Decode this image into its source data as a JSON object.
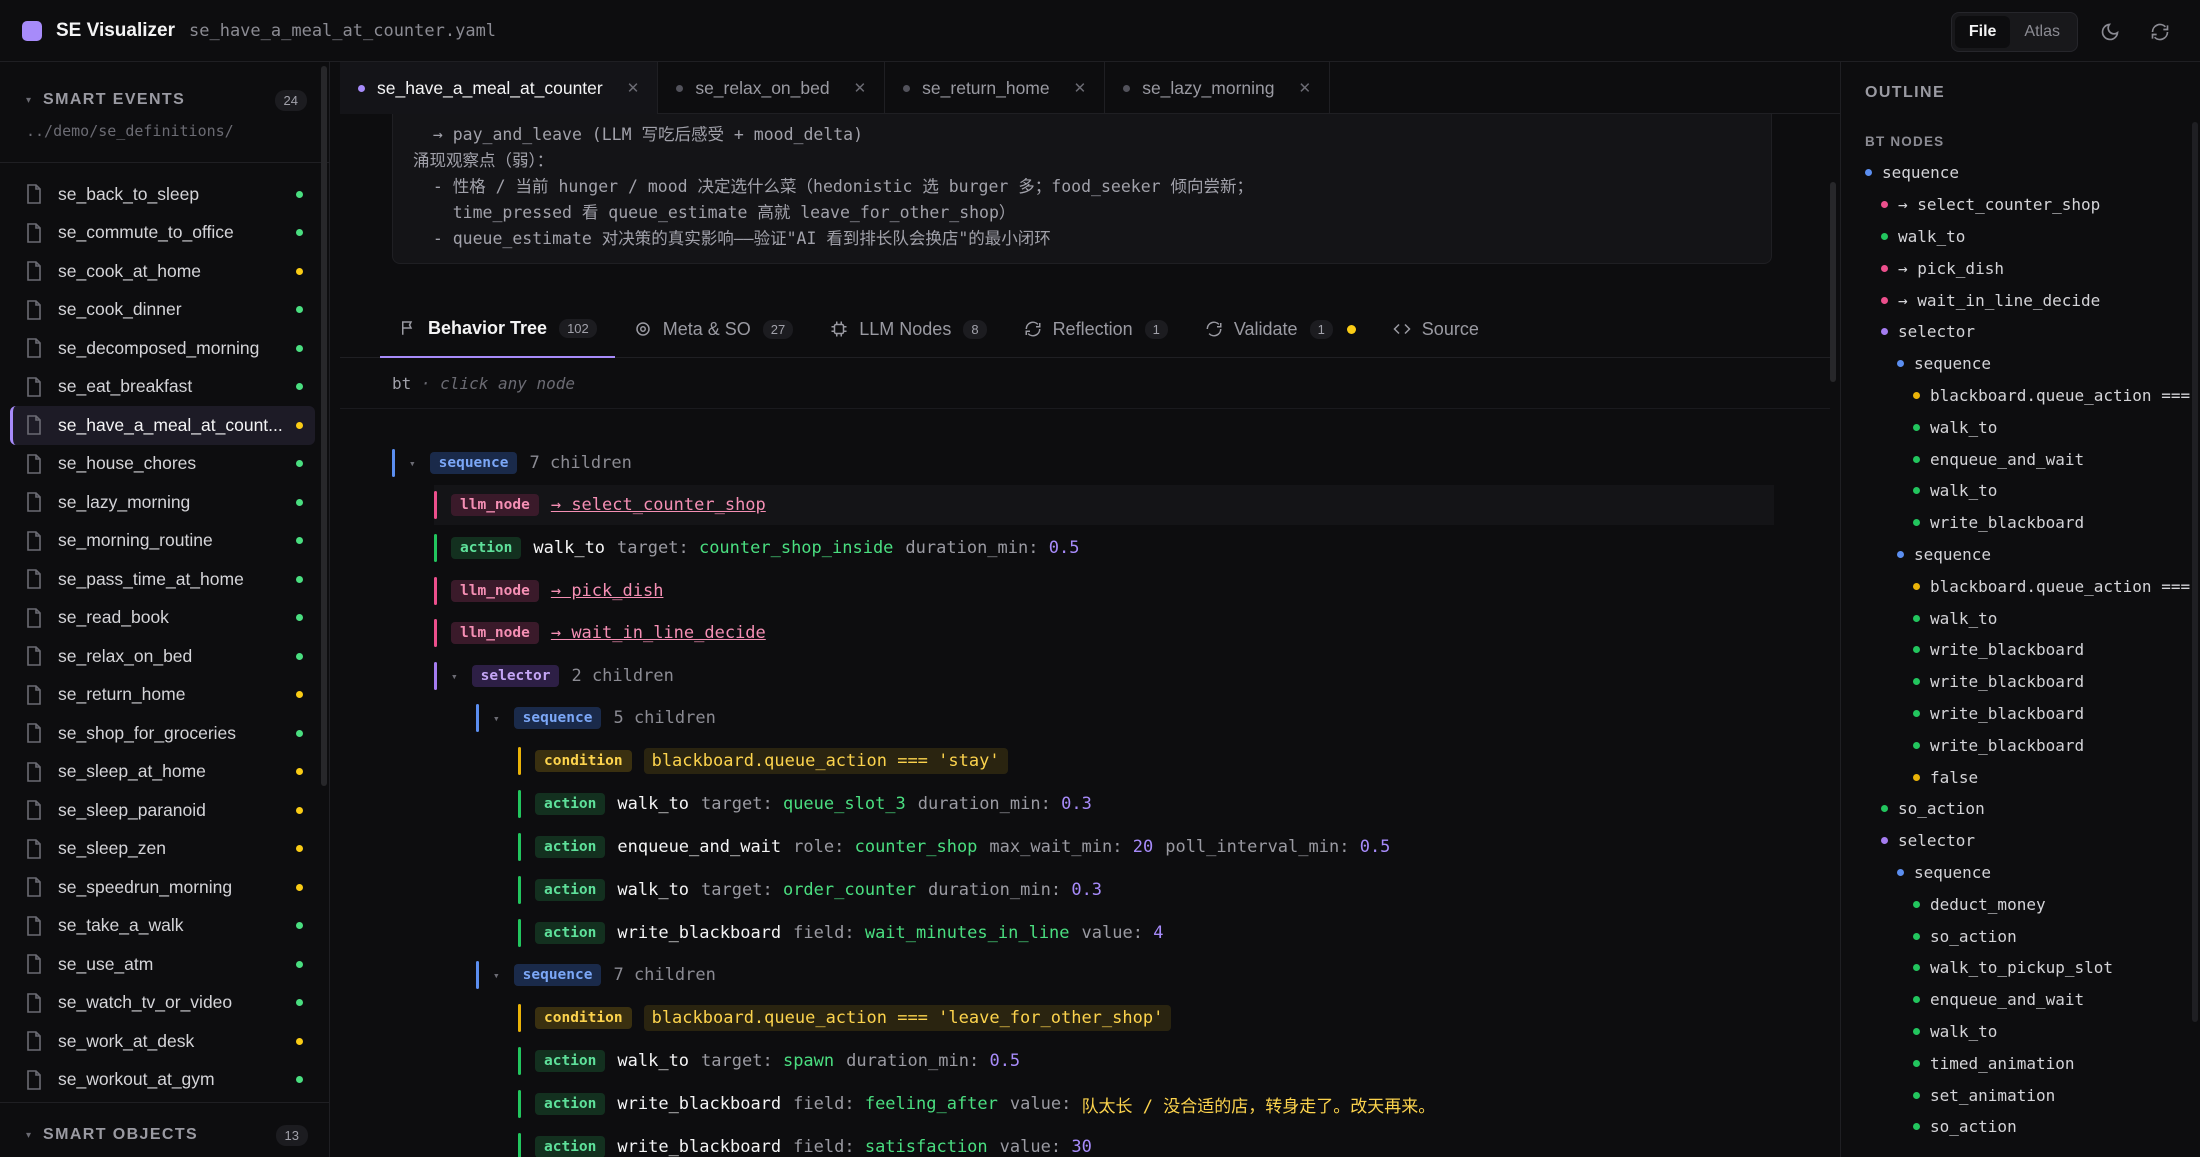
{
  "header": {
    "app_title": "SE Visualizer",
    "file_name": "se_have_a_meal_at_counter.yaml",
    "mode_file": "File",
    "mode_atlas": "Atlas"
  },
  "sidebar": {
    "smart_events_label": "SMART EVENTS",
    "smart_events_count": "24",
    "path": "../demo/se_definitions/",
    "items": [
      {
        "name": "se_back_to_sleep",
        "status": "green"
      },
      {
        "name": "se_commute_to_office",
        "status": "green"
      },
      {
        "name": "se_cook_at_home",
        "status": "yellow"
      },
      {
        "name": "se_cook_dinner",
        "status": "green"
      },
      {
        "name": "se_decomposed_morning",
        "status": "green"
      },
      {
        "name": "se_eat_breakfast",
        "status": "green"
      },
      {
        "name": "se_have_a_meal_at_count...",
        "status": "yellow",
        "active": true
      },
      {
        "name": "se_house_chores",
        "status": "green"
      },
      {
        "name": "se_lazy_morning",
        "status": "green"
      },
      {
        "name": "se_morning_routine",
        "status": "green"
      },
      {
        "name": "se_pass_time_at_home",
        "status": "green"
      },
      {
        "name": "se_read_book",
        "status": "green"
      },
      {
        "name": "se_relax_on_bed",
        "status": "green"
      },
      {
        "name": "se_return_home",
        "status": "yellow"
      },
      {
        "name": "se_shop_for_groceries",
        "status": "green"
      },
      {
        "name": "se_sleep_at_home",
        "status": "yellow"
      },
      {
        "name": "se_sleep_paranoid",
        "status": "yellow"
      },
      {
        "name": "se_sleep_zen",
        "status": "yellow"
      },
      {
        "name": "se_speedrun_morning",
        "status": "yellow"
      },
      {
        "name": "se_take_a_walk",
        "status": "green"
      },
      {
        "name": "se_use_atm",
        "status": "green"
      },
      {
        "name": "se_watch_tv_or_video",
        "status": "green"
      },
      {
        "name": "se_work_at_desk",
        "status": "yellow"
      },
      {
        "name": "se_workout_at_gym",
        "status": "green"
      }
    ],
    "smart_objects_label": "SMART OBJECTS",
    "smart_objects_count": "13"
  },
  "tabs": [
    {
      "label": "se_have_a_meal_at_counter",
      "active": true
    },
    {
      "label": "se_relax_on_bed"
    },
    {
      "label": "se_return_home"
    },
    {
      "label": "se_lazy_morning"
    }
  ],
  "notes": {
    "lines": [
      "  → pay_and_leave (LLM 写吃后感受 + mood_delta)",
      "涌现观察点（弱）：",
      "  - 性格 / 当前 hunger / mood 决定选什么菜（hedonistic 选 burger 多；food_seeker 倾向尝新；",
      "    time_pressed 看 queue_estimate 高就 leave_for_other_shop）",
      "  - queue_estimate 对决策的真实影响——验证\"AI 看到排长队会换店\"的最小闭环"
    ]
  },
  "subtabs": [
    {
      "label": "Behavior Tree",
      "count": "102",
      "active": true
    },
    {
      "label": "Meta & SO",
      "count": "27"
    },
    {
      "label": "LLM Nodes",
      "count": "8"
    },
    {
      "label": "Reflection",
      "count": "1"
    },
    {
      "label": "Validate",
      "count": "1"
    },
    {
      "label": "Source"
    }
  ],
  "bt": {
    "label": "bt",
    "hint": "· click any node"
  },
  "tree": {
    "root": {
      "tag": "sequence",
      "meta": "7 children"
    },
    "n1": {
      "tag": "llm_node",
      "link": "→ select_counter_shop"
    },
    "n2": {
      "tag": "action",
      "fn": "walk_to",
      "k1": "target:",
      "v1": "counter_shop_inside",
      "k2": "duration_min:",
      "v2": "0.5"
    },
    "n3": {
      "tag": "llm_node",
      "link": "→ pick_dish"
    },
    "n4": {
      "tag": "llm_node",
      "link": "→ wait_in_line_decide"
    },
    "n5": {
      "tag": "selector",
      "meta": "2 children"
    },
    "n6": {
      "tag": "sequence",
      "meta": "5 children"
    },
    "n7": {
      "tag": "condition",
      "expr": "blackboard.queue_action === 'stay'"
    },
    "n8": {
      "tag": "action",
      "fn": "walk_to",
      "k1": "target:",
      "v1": "queue_slot_3",
      "k2": "duration_min:",
      "v2": "0.3"
    },
    "n9": {
      "tag": "action",
      "fn": "enqueue_and_wait",
      "k1": "role:",
      "v1": "counter_shop",
      "k2": "max_wait_min:",
      "v2": "20",
      "k3": "poll_interval_min:",
      "v3": "0.5"
    },
    "n10": {
      "tag": "action",
      "fn": "walk_to",
      "k1": "target:",
      "v1": "order_counter",
      "k2": "duration_min:",
      "v2": "0.3"
    },
    "n11": {
      "tag": "action",
      "fn": "write_blackboard",
      "k1": "field:",
      "v1": "wait_minutes_in_line",
      "k2": "value:",
      "v2": "4"
    },
    "n12": {
      "tag": "sequence",
      "meta": "7 children"
    },
    "n13": {
      "tag": "condition",
      "expr": "blackboard.queue_action === 'leave_for_other_shop'"
    },
    "n14": {
      "tag": "action",
      "fn": "walk_to",
      "k1": "target:",
      "v1": "spawn",
      "k2": "duration_min:",
      "v2": "0.5"
    },
    "n15": {
      "tag": "action",
      "fn": "write_blackboard",
      "k1": "field:",
      "v1": "feeling_after",
      "k2": "value:",
      "v2": "队太长 / 没合适的店，转身走了。改天再来。"
    },
    "n16": {
      "tag": "action",
      "fn": "write_blackboard",
      "k1": "field:",
      "v1": "satisfaction",
      "k2": "value:",
      "v2": "30"
    }
  },
  "outline": {
    "title": "OUTLINE",
    "sub": "BT NODES",
    "items": [
      {
        "label": "sequence",
        "type": "seq",
        "indent": 0
      },
      {
        "label": "→ select_counter_shop",
        "type": "llm",
        "indent": 1
      },
      {
        "label": "walk_to",
        "type": "act",
        "indent": 1
      },
      {
        "label": "→ pick_dish",
        "type": "llm",
        "indent": 1
      },
      {
        "label": "→ wait_in_line_decide",
        "type": "llm",
        "indent": 1
      },
      {
        "label": "selector",
        "type": "sel",
        "indent": 1
      },
      {
        "label": "sequence",
        "type": "seq",
        "indent": 2
      },
      {
        "label": "blackboard.queue_action ===",
        "type": "cond",
        "indent": 3
      },
      {
        "label": "walk_to",
        "type": "act",
        "indent": 3
      },
      {
        "label": "enqueue_and_wait",
        "type": "act",
        "indent": 3
      },
      {
        "label": "walk_to",
        "type": "act",
        "indent": 3
      },
      {
        "label": "write_blackboard",
        "type": "act",
        "indent": 3
      },
      {
        "label": "sequence",
        "type": "seq",
        "indent": 2
      },
      {
        "label": "blackboard.queue_action ===",
        "type": "cond",
        "indent": 3
      },
      {
        "label": "walk_to",
        "type": "act",
        "indent": 3
      },
      {
        "label": "write_blackboard",
        "type": "act",
        "indent": 3
      },
      {
        "label": "write_blackboard",
        "type": "act",
        "indent": 3
      },
      {
        "label": "write_blackboard",
        "type": "act",
        "indent": 3
      },
      {
        "label": "write_blackboard",
        "type": "act",
        "indent": 3
      },
      {
        "label": "false",
        "type": "cond",
        "indent": 3
      },
      {
        "label": "so_action",
        "type": "act",
        "indent": 1
      },
      {
        "label": "selector",
        "type": "sel",
        "indent": 1
      },
      {
        "label": "sequence",
        "type": "seq",
        "indent": 2
      },
      {
        "label": "deduct_money",
        "type": "act",
        "indent": 3
      },
      {
        "label": "so_action",
        "type": "act",
        "indent": 3
      },
      {
        "label": "walk_to_pickup_slot",
        "type": "act",
        "indent": 3
      },
      {
        "label": "enqueue_and_wait",
        "type": "act",
        "indent": 3
      },
      {
        "label": "walk_to",
        "type": "act",
        "indent": 3
      },
      {
        "label": "timed_animation",
        "type": "act",
        "indent": 3
      },
      {
        "label": "set_animation",
        "type": "act",
        "indent": 3
      },
      {
        "label": "so_action",
        "type": "act",
        "indent": 3
      }
    ]
  }
}
